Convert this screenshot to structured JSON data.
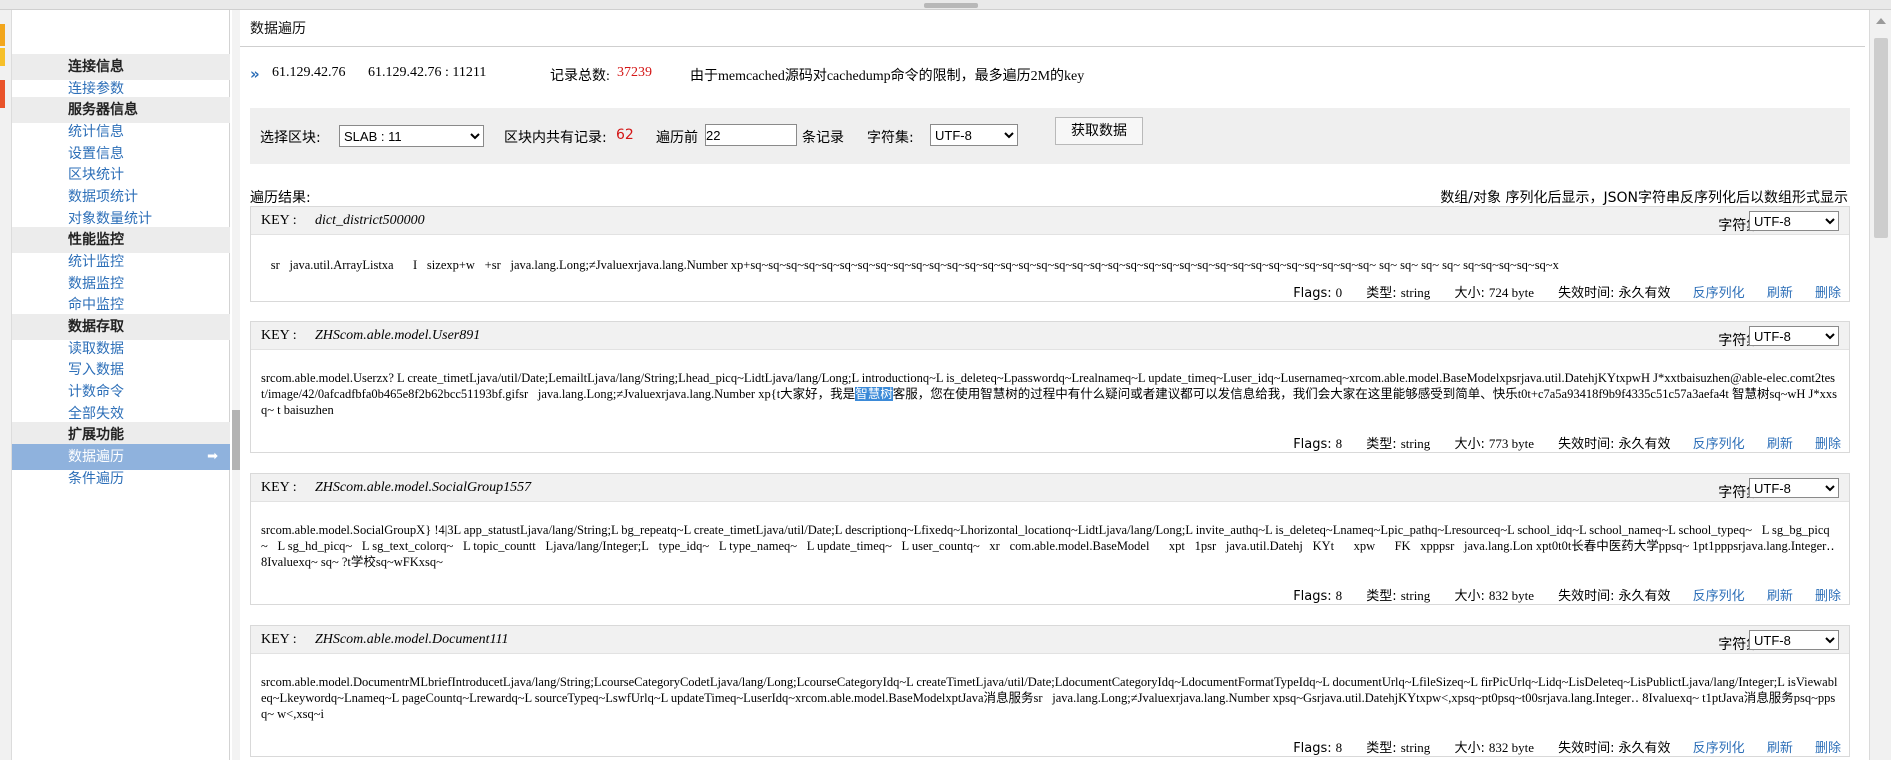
{
  "sidebar": {
    "groups": [
      {
        "label": "连接信息"
      },
      {
        "label": "服务器信息"
      },
      {
        "label": "性能监控"
      },
      {
        "label": "数据存取"
      },
      {
        "label": "扩展功能"
      }
    ],
    "items": [
      {
        "label": "连接参数"
      },
      {
        "label": "统计信息"
      },
      {
        "label": "设置信息"
      },
      {
        "label": "区块统计"
      },
      {
        "label": "数据项统计"
      },
      {
        "label": "对象数量统计"
      },
      {
        "label": "统计监控"
      },
      {
        "label": "数据监控"
      },
      {
        "label": "命中监控"
      },
      {
        "label": "读取数据"
      },
      {
        "label": "写入数据"
      },
      {
        "label": "计数命令"
      },
      {
        "label": "全部失效"
      },
      {
        "label": "数据遍历"
      },
      {
        "label": "条件遍历"
      }
    ],
    "active_arrow": "➡"
  },
  "page": {
    "title": "数据遍历",
    "chevron": "»",
    "server_ip": "61.129.42.76",
    "server_addr": "61.129.42.76 : 11211",
    "total_label": "记录总数:",
    "total_value": "37239",
    "notice": "由于memcached源码对cachedump命令的限制，最多遍历2M的key"
  },
  "controls": {
    "slab_label": "选择区块:",
    "slab_value": "SLAB : 11",
    "block_records_label": "区块内共有记录:",
    "block_records_value": "62",
    "traverse_label": "遍历前",
    "traverse_value": "22",
    "records_suffix": "条记录",
    "charset_label": "字符集:",
    "charset_value": "UTF-8",
    "fetch_button": "获取数据"
  },
  "results": {
    "label": "遍历结果:",
    "note": "数组/对象 序列化后显示，JSON字符串反序列化后以数组形式显示"
  },
  "entry_labels": {
    "key": "KEY :",
    "charset": "字符集:",
    "flags": "Flags:",
    "type": "类型:",
    "size": "大小:",
    "expire": "失效时间:",
    "deserialize": "反序列化",
    "refresh": "刷新",
    "delete": "删除"
  },
  "entries": [
    {
      "key": "dict_district500000",
      "charset": "UTF-8",
      "body": "\u0000sr\u0000java.util.ArrayListxa\u0000\u0000I\u0000sizexp+w\u0000+sr\u0000java.lang.Long;≠Jvaluexrjava.lang.Number xp+sq~sq~sq~sq~sq~sq~sq~sq~sq~sq~sq~sq~sq~sq~sq~sq~sq~sq~sq~sq~sq~sq~sq~sq~sq~sq~sq~sq~sq~sq~sq~sq~sq~sq~sq~ sq~ sq~ sq~ sq~ sq~sq~sq~sq~sq~x",
      "flags": "0",
      "type": "string",
      "size": "724 byte",
      "expire": "永久有效"
    },
    {
      "key": "ZHScom.able.model.User891",
      "charset": "UTF-8",
      "body_before": "srcom.able.model.Userzx?  L create_timetLjava/util/Date;LemailtLjava/lang/String;Lhead_picq~LidtLjava/lang/Long;L introductionq~L is_deleteq~Lpasswordq~Lrealnameq~L update_timeq~Luser_idq~Lusernameq~xrcom.able.model.BaseModelxpsrjava.util.DatehjKYtxpwH J*xxtbaisuzhen@able-elec.comt2test/image/42/0afcadfbfa0b465e8f2b62bcc51193bf.gifsr\u0000java.lang.Long;≠Jvaluexrjava.lang.Number xp{t大家好，我是",
      "body_highlight": "智慧树",
      "body_after": "客服，您在使用智慧树的过程中有什么疑问或者建议都可以发信息给我，我们会大家在这里能够感受到简单、快乐t0t+c7a5a93418f9b9f4335c51c57a3aefa4t 智慧树sq~wH J*xxsq~ t baisuzhen",
      "flags": "8",
      "type": "string",
      "size": "773 byte",
      "expire": "永久有效"
    },
    {
      "key": "ZHScom.able.model.SocialGroup1557",
      "charset": "UTF-8",
      "body": "srcom.able.model.SocialGroupX} !4|3L app_statustLjava/lang/String;L bg_repeatq~L create_timetLjava/util/Date;L descriptionq~Lfixedq~Lhorizontal_locationq~LidtLjava/lang/Long;L invite_authq~L is_deleteq~Lnameq~Lpic_pathq~Lresourceq~L school_idq~L school_nameq~L school_typeq~\u0000L sg_bg_picq~\u0000L sg_hd_picq~\u0000L sg_text_colorq~\u0000L topic_countt\u0000Ljava/lang/Integer;L\u0000type_idq~\u0000L type_nameq~\u0000L update_timeq~\u0000L user_countq~\u0000xr\u0000com.able.model.BaseModel\u0000\u0000xpt\u00001psr\u0000java.util.Datehj\u0000KYt\u0000\u0000xpw\u0000\u0000FK\u0000xpppsr\u0000java.lang.Lon xpt0t0t长春中医药大学ppsq~ 1pt1pppsrjava.lang.Integer‥ 8Ivaluexq~ sq~ ?t学校sq~wFKxsq~",
      "flags": "8",
      "type": "string",
      "size": "832 byte",
      "expire": "永久有效"
    },
    {
      "key": "ZHScom.able.model.Document111",
      "charset": "UTF-8",
      "body": "srcom.able.model.DocumentrMLbriefIntroducetLjava/lang/String;LcourseCategoryCodetLjava/lang/Long;LcourseCategoryIdq~L createTimetLjava/util/Date;LdocumentCategoryIdq~LdocumentFormatTypeIdq~L documentUrlq~LfileSizeq~L firPicUrlq~Lidq~LisDeleteq~LisPublictLjava/lang/Integer;L isViewableq~Lkeywordq~Lnameq~L pageCountq~Lrewardq~L sourceTypeq~LswfUrlq~L updateTimeq~LuserIdq~xrcom.able.model.BaseModelxptJava消息服务sr\u0000java.lang.Long;≠Jvaluexrjava.lang.Number xpsq~Gsrjava.util.DatehjKYtxpw<,xpsq~pt0psq~t00srjava.lang.Integer‥ 8Ivaluexq~ t1ptJava消息服务psq~ppsq~ w<,xsq~i",
      "flags": "8",
      "type": "string",
      "size": "832 byte",
      "expire": "永久有效"
    }
  ],
  "colors": {
    "link": "#2d6fb8",
    "highlight_red": "#d41616",
    "active_item": "#8fb2dd"
  }
}
